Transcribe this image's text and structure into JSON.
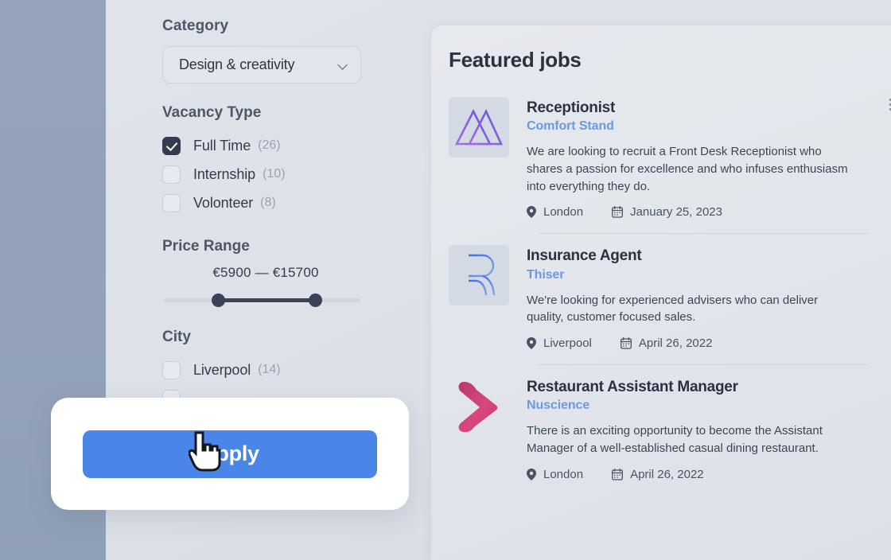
{
  "theme": {
    "left_strip": "#96a5bb",
    "background": "#dde1e8",
    "panel": "#e3e7ed",
    "accent_blue": "#4a86e8",
    "company_link": "#6b9ae0",
    "text_dark": "#2b3142",
    "muted": "#9aa3b3",
    "checkbox_checked": "#343b4f",
    "slider_fill": "#3d4459"
  },
  "sidebar": {
    "category": {
      "heading": "Category",
      "selected": "Design & creativity",
      "chevron_icon": "chevron-down-icon"
    },
    "vacancy_type": {
      "heading": "Vacancy Type",
      "options": [
        {
          "label": "Full Time",
          "count": "(26)",
          "checked": true
        },
        {
          "label": "Internship",
          "count": "(10)",
          "checked": false
        },
        {
          "label": "Volonteer",
          "count": "(8)",
          "checked": false
        }
      ]
    },
    "price_range": {
      "heading": "Price Range",
      "min_label": "€5900",
      "separator": "—",
      "max_label": "€15700",
      "display": "€5900 — €15700"
    },
    "city": {
      "heading": "City",
      "options": [
        {
          "label": "Liverpool",
          "count": "(14)",
          "checked": false
        }
      ]
    }
  },
  "jobs_panel": {
    "title": "Featured jobs",
    "jobs": [
      {
        "title": "Receptionist",
        "company": "Comfort Stand",
        "description": "We are looking to recruit a Front Desk Receptionist who shares a passion for excellence and who infuses enthusiasm into everything they do.",
        "location": "London",
        "date": "January 25, 2023",
        "location_icon": "map-pin-icon",
        "date_icon": "calendar-icon",
        "logo": "overlapping-triangles-logo"
      },
      {
        "title": "Insurance Agent",
        "company": "Thiser",
        "description": "We're looking for experienced advisers who can deliver quality, customer focused sales.",
        "location": "Liverpool",
        "date": "April 26, 2022",
        "location_icon": "map-pin-icon",
        "date_icon": "calendar-icon",
        "logo": "letter-r-monogram-logo"
      },
      {
        "title": "Restaurant Assistant Manager",
        "company": "Nuscience",
        "description": "There is an exciting opportunity to become the Assistant Manager of a well-established casual dining restaurant.",
        "location": "London",
        "date": "April 26, 2022",
        "location_icon": "map-pin-icon",
        "date_icon": "calendar-icon",
        "logo": "pink-chevron-logo"
      }
    ]
  },
  "apply_overlay": {
    "button_label": "Apply",
    "cursor_icon": "pointing-hand-cursor"
  }
}
